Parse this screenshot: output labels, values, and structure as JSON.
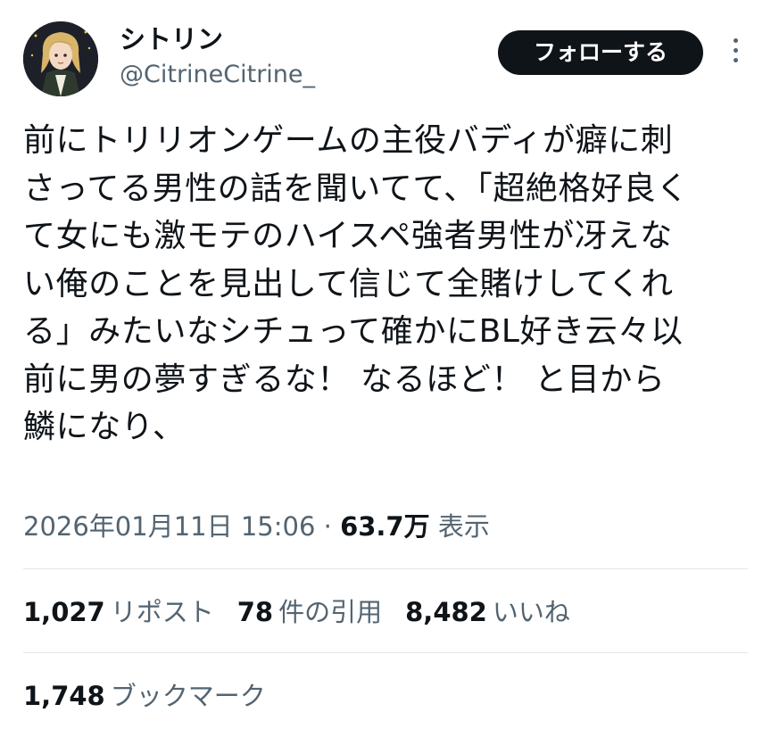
{
  "author": {
    "display_name": "シトリン",
    "handle": "@CitrineCitrine_"
  },
  "actions": {
    "follow_label": "フォローする",
    "more_icon": "more-vertical-icon"
  },
  "tweet": {
    "lines": [
      "前にトリリオンゲームの主役バディが癖に刺",
      "さってる男性の話を聞いてて、「超絶格好良く",
      "て女にも激モテのハイスペ強者男性が冴えな",
      "い俺のことを見出して信じて全賭けしてくれ",
      "る」みたいなシチュって確かにBL好き云々以",
      "前に男の夢すぎるな！ なるほど！ と目から",
      "鱗になり、"
    ]
  },
  "meta": {
    "datetime": "2026年01月11日 15:06",
    "separator": " · ",
    "views_count": "63.7万",
    "views_label": "表示"
  },
  "stats": {
    "reposts": {
      "count": "1,027",
      "label": "リポスト"
    },
    "quotes": {
      "count": "78",
      "label": "件の引用"
    },
    "likes": {
      "count": "8,482",
      "label": "いいね"
    },
    "bookmarks": {
      "count": "1,748",
      "label": "ブックマーク"
    }
  },
  "colors": {
    "text_primary": "#0f1419",
    "text_secondary": "#536471",
    "divider": "#e1e6ea",
    "follow_bg": "#0f1419"
  }
}
